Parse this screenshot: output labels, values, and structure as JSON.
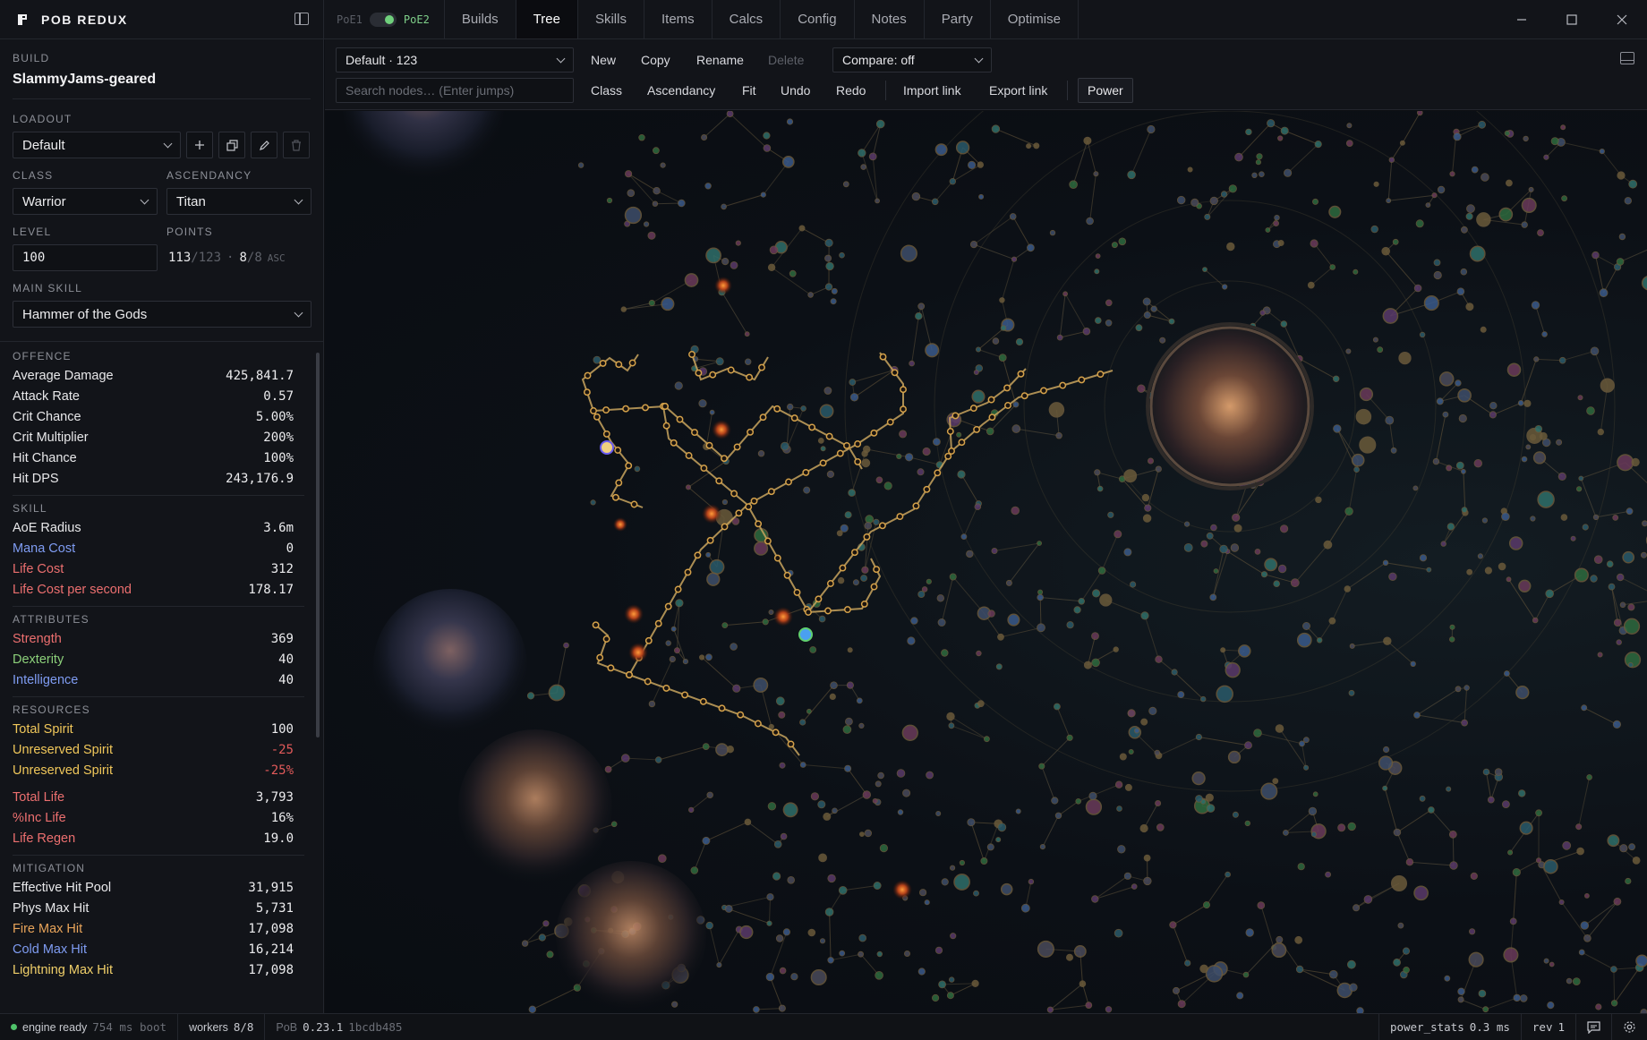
{
  "app": {
    "brand": "POB REDUX"
  },
  "game_toggle": {
    "left": "PoE1",
    "right": "PoE2"
  },
  "tabs": [
    {
      "label": "Builds"
    },
    {
      "label": "Tree"
    },
    {
      "label": "Skills"
    },
    {
      "label": "Items"
    },
    {
      "label": "Calcs"
    },
    {
      "label": "Config"
    },
    {
      "label": "Notes"
    },
    {
      "label": "Party"
    },
    {
      "label": "Optimise"
    }
  ],
  "active_tab": "Tree",
  "sidebar": {
    "build_label": "BUILD",
    "build_name": "SlammyJams-geared",
    "loadout_label": "LOADOUT",
    "loadout_value": "Default",
    "class_label": "CLASS",
    "class_value": "Warrior",
    "ascendancy_label": "ASCENDANCY",
    "ascendancy_value": "Titan",
    "level_label": "LEVEL",
    "level_value": "100",
    "points_label": "POINTS",
    "points_used": "113",
    "points_total": "/123",
    "asc_used": "8",
    "asc_total": "/8",
    "asc_suffix": "ASC",
    "main_skill_label": "MAIN SKILL",
    "main_skill_value": "Hammer of the Gods"
  },
  "stats": {
    "offence": {
      "title": "OFFENCE",
      "rows": [
        {
          "label": "Average Damage",
          "value": "425,841.7",
          "color": "default"
        },
        {
          "label": "Attack Rate",
          "value": "0.57",
          "color": "default"
        },
        {
          "label": "Crit Chance",
          "value": "5.00%",
          "color": "default"
        },
        {
          "label": "Crit Multiplier",
          "value": "200%",
          "color": "default"
        },
        {
          "label": "Hit Chance",
          "value": "100%",
          "color": "default"
        },
        {
          "label": "Hit DPS",
          "value": "243,176.9",
          "color": "default"
        }
      ]
    },
    "skill": {
      "title": "SKILL",
      "rows": [
        {
          "label": "AoE Radius",
          "value": "3.6m",
          "color": "default"
        },
        {
          "label": "Mana Cost",
          "value": "0",
          "color": "blue"
        },
        {
          "label": "Life Cost",
          "value": "312",
          "color": "red"
        },
        {
          "label": "Life Cost per second",
          "value": "178.17",
          "color": "red"
        }
      ]
    },
    "attributes": {
      "title": "ATTRIBUTES",
      "rows": [
        {
          "label": "Strength",
          "value": "369",
          "color": "red"
        },
        {
          "label": "Dexterity",
          "value": "40",
          "color": "green"
        },
        {
          "label": "Intelligence",
          "value": "40",
          "color": "blue"
        }
      ]
    },
    "resources": {
      "title": "RESOURCES",
      "rows": [
        {
          "label": "Total Spirit",
          "value": "100",
          "color": "gold"
        },
        {
          "label": "Unreserved Spirit",
          "value": "-25",
          "color": "gold",
          "neg": true
        },
        {
          "label": "Unreserved Spirit",
          "value": "-25%",
          "color": "gold",
          "neg": true
        }
      ],
      "rows2": [
        {
          "label": "Total Life",
          "value": "3,793",
          "color": "red"
        },
        {
          "label": "%Inc Life",
          "value": "16%",
          "color": "red"
        },
        {
          "label": "Life Regen",
          "value": "19.0",
          "color": "red"
        }
      ]
    },
    "mitigation": {
      "title": "MITIGATION",
      "rows": [
        {
          "label": "Effective Hit Pool",
          "value": "31,915",
          "color": "default"
        },
        {
          "label": "Phys Max Hit",
          "value": "5,731",
          "color": "default"
        },
        {
          "label": "Fire Max Hit",
          "value": "17,098",
          "color": "orange"
        },
        {
          "label": "Cold Max Hit",
          "value": "16,214",
          "color": "blue"
        },
        {
          "label": "Lightning Max Hit",
          "value": "17,098",
          "color": "lightning"
        }
      ]
    }
  },
  "toolbar": {
    "spec_select": "Default · 123",
    "new": "New",
    "copy": "Copy",
    "rename": "Rename",
    "delete": "Delete",
    "compare": "Compare: off",
    "search_placeholder": "Search nodes… (Enter jumps)",
    "class": "Class",
    "ascendancy": "Ascendancy",
    "fit": "Fit",
    "undo": "Undo",
    "redo": "Redo",
    "import_link": "Import link",
    "export_link": "Export link",
    "power": "Power"
  },
  "statusbar": {
    "engine": "engine ready",
    "boot": "754 ms boot",
    "workers_label": "workers",
    "workers_value": "8/8",
    "pob_label": "PoB",
    "pob_version": "0.23.1",
    "commit": "1bcdb485",
    "power_stats_label": "power_stats",
    "power_stats_value": "0.3 ms",
    "rev_label": "rev",
    "rev_value": "1"
  },
  "colors": {
    "accent_green": "#6fd07c",
    "tree_path": "#c8a45e",
    "node_allocated": "#d4a14a",
    "red_attr": "#ec6f6f",
    "blue_attr": "#7f9cf2",
    "gold_spirit": "#f0c75a"
  }
}
